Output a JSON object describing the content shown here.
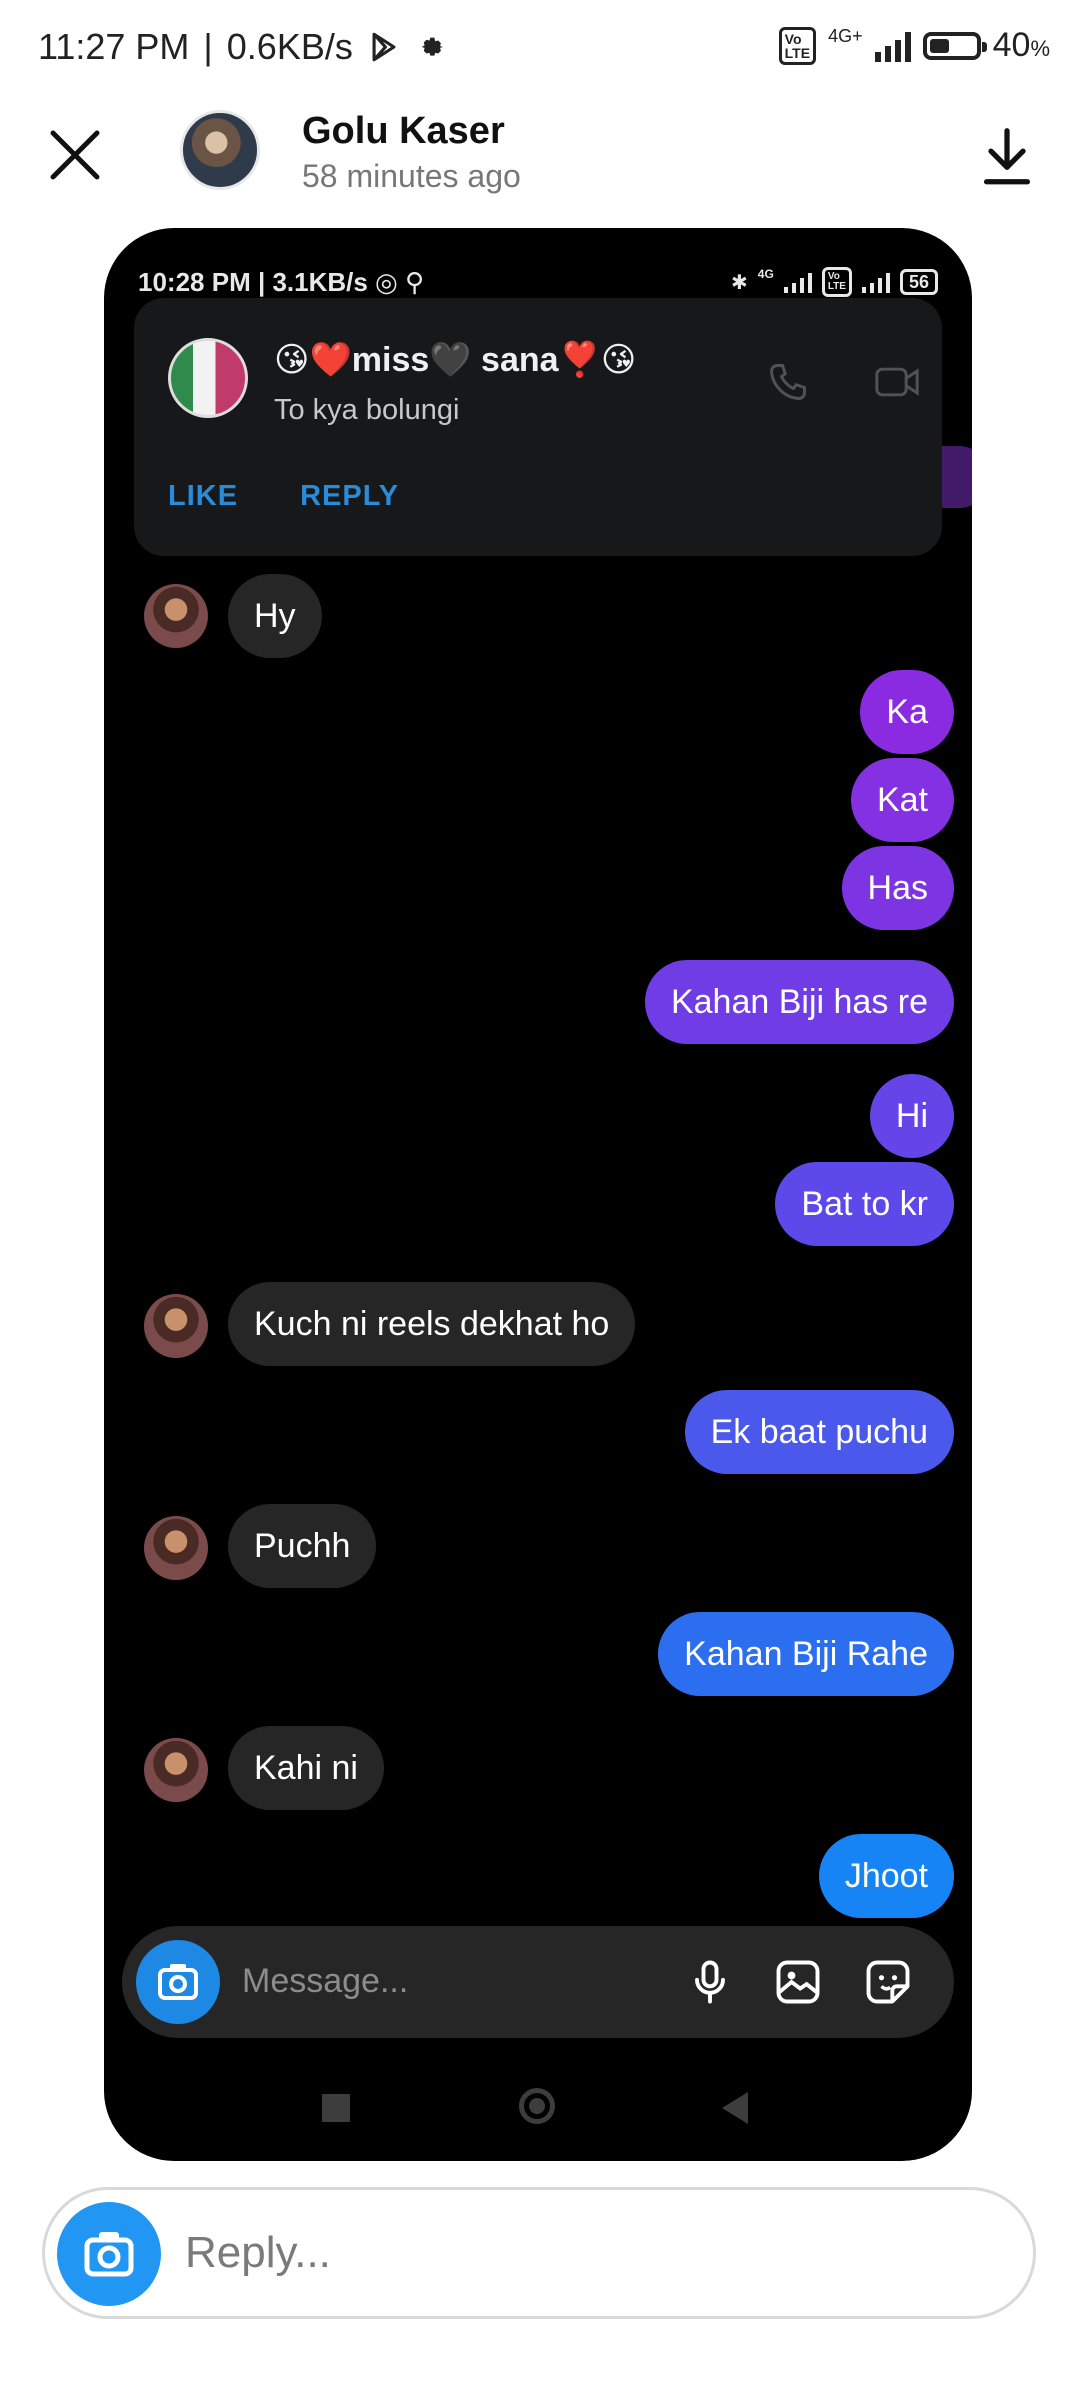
{
  "status_bar": {
    "time": "11:27 PM",
    "speed": "0.6KB/s",
    "network": "4G+",
    "battery_pct": "40",
    "battery_unit": "%"
  },
  "header": {
    "name": "Golu Kaser",
    "time_ago": "58 minutes ago"
  },
  "screenshot": {
    "status": {
      "left": "10:28 PM | 3.1KB/s",
      "net": "4G",
      "battery": "56"
    },
    "notification": {
      "title": "😘❤️miss🖤 sana❣️😘",
      "body": "To kya bolungi",
      "like": "LIKE",
      "reply": "REPLY"
    },
    "messages": [
      {
        "dir": "in",
        "text": "Hy"
      },
      {
        "dir": "out",
        "text": "Ka"
      },
      {
        "dir": "out",
        "text": "Kat"
      },
      {
        "dir": "out",
        "text": "Has"
      },
      {
        "dir": "out",
        "text": "Kahan Biji has re"
      },
      {
        "dir": "out",
        "text": "Hi"
      },
      {
        "dir": "out",
        "text": "Bat to kr"
      },
      {
        "dir": "in",
        "text": "Kuch ni reels dekhat ho"
      },
      {
        "dir": "out",
        "text": "Ek baat puchu"
      },
      {
        "dir": "in",
        "text": "Puchh"
      },
      {
        "dir": "out",
        "text": "Kahan Biji Rahe"
      },
      {
        "dir": "in",
        "text": "Kahi ni"
      },
      {
        "dir": "out",
        "text": "Jhoot"
      }
    ],
    "colors": {
      "purple_top": "#8a2be2",
      "purple_mid": "#6a3de8",
      "blue_low": "#2c6ef0",
      "blue_bottom": "#1784f5",
      "received": "#262626"
    },
    "composer_placeholder": "Message..."
  },
  "reply_bar": {
    "placeholder": "Reply..."
  }
}
